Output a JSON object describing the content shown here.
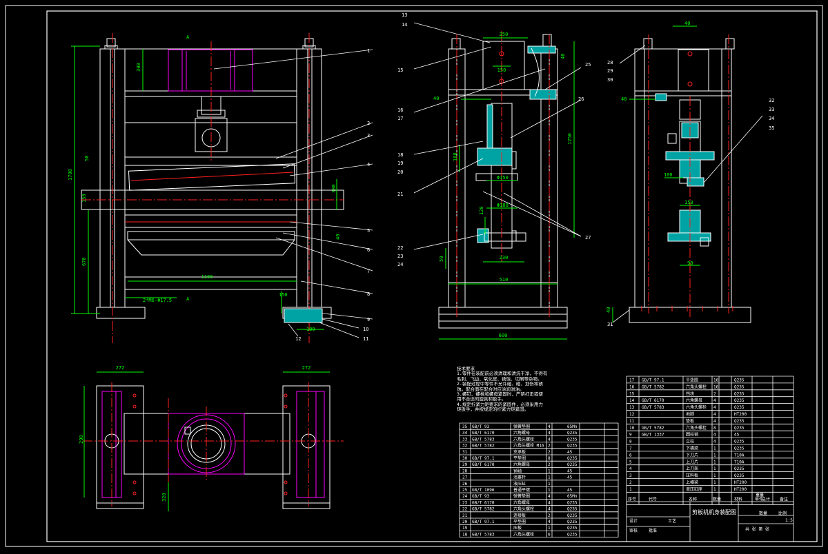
{
  "drawing": {
    "title": "剪板机机身装配图",
    "scale": "1:5",
    "colors": {
      "outline": "#ffffff",
      "section": "#00a3a3",
      "centerline": "#ff2020",
      "hidden": "#ff00ff",
      "dimension": "#00ff00",
      "background": "#000000"
    }
  },
  "front_view": {
    "section_mark_top": "A",
    "section_mark_bottom": "A",
    "dims": {
      "overall_height": "1700",
      "upper": "300",
      "left_gap": "50",
      "mid_left": "150",
      "mid_right": "300",
      "lower": "670",
      "width": "1100",
      "holes": "2*M6-Φ17.5",
      "slot": "150",
      "base": "100",
      "right_small": "40"
    },
    "balloons": [
      "1",
      "2",
      "3",
      "4",
      "5",
      "6",
      "7",
      "8",
      "9",
      "10",
      "11",
      "12"
    ]
  },
  "side_view": {
    "dims": {
      "top": "250",
      "top_right": "40",
      "bolt": "150",
      "height": "1250",
      "left": "40",
      "mid": "100",
      "dia1": "Φ150",
      "dia2": "Φ180",
      "low": "120",
      "base_left": "50",
      "inner": "230",
      "frame": "510",
      "base": "600"
    },
    "balloons": [
      "13",
      "14",
      "15",
      "16",
      "17",
      "18",
      "19",
      "20",
      "21",
      "22",
      "23",
      "24",
      "25",
      "26",
      "27"
    ]
  },
  "right_view": {
    "dims": {
      "top": "40",
      "left": "40",
      "a": "100",
      "b": "90",
      "gap": "150",
      "base": "40"
    },
    "balloons": [
      "28",
      "29",
      "30",
      "31",
      "32",
      "33",
      "34",
      "35"
    ]
  },
  "plan_view": {
    "dims": {
      "left_width": "272",
      "right_width": "272",
      "height": "290",
      "bottom": "320"
    }
  },
  "technical_notes": {
    "heading": "技术要求",
    "lines": [
      "1.零件在装配前必须清理和清洗干净，不得有",
      "毛刺、飞边、氧化皮、锈蚀、切屑等杂物。",
      "2.装配过程中零件不允许磕、碰、划伤和锈",
      "蚀。配合面在配合时应涂润滑油。",
      "3.螺钉、螺栓和螺母紧固时，严禁打击或使",
      "用不合适的旋具和扳手。",
      "4.规定拧紧力矩要求的紧固件，必须采用力",
      "矩扳手，并按规定的拧紧力矩紧固。"
    ]
  },
  "bom_left": {
    "rows": [
      [
        "35",
        "GB/T 93",
        "弹簧垫圈",
        "4",
        "65Mn",
        ""
      ],
      [
        "34",
        "GB/T 6170",
        "六角螺母",
        "4",
        "Q235",
        ""
      ],
      [
        "33",
        "GB/T 5783",
        "六角头螺栓",
        "4",
        "Q235",
        ""
      ],
      [
        "32",
        "GB/T 5782",
        "六角头螺栓 M16",
        "2",
        "Q235",
        ""
      ],
      [
        "31",
        "",
        "支承板",
        "2",
        "45",
        ""
      ],
      [
        "30",
        "GB/T 97.1",
        "平垫圈",
        "8",
        "Q235",
        ""
      ],
      [
        "29",
        "GB/T 6170",
        "六角螺母",
        "2",
        "Q235",
        ""
      ],
      [
        "28",
        "",
        "销轴",
        "1",
        "45",
        ""
      ],
      [
        "27",
        "",
        "活塞杆",
        "1",
        "45",
        ""
      ],
      [
        "26",
        "",
        "液压缸",
        "1",
        "",
        ""
      ],
      [
        "25",
        "GB/T 1096",
        "普通平键",
        "1",
        "45",
        ""
      ],
      [
        "24",
        "GB/T 93",
        "弹簧垫圈",
        "4",
        "65Mn",
        ""
      ],
      [
        "23",
        "GB/T 6170",
        "六角螺母",
        "4",
        "Q235",
        ""
      ],
      [
        "22",
        "GB/T 5782",
        "六角头螺栓",
        "4",
        "Q235",
        ""
      ],
      [
        "21",
        "",
        "连接板",
        "2",
        "Q235",
        ""
      ],
      [
        "20",
        "GB/T 97.1",
        "平垫圈",
        "4",
        "Q235",
        ""
      ],
      [
        "19",
        "",
        "压板",
        "1",
        "Q235",
        ""
      ],
      [
        "18",
        "GB/T 5783",
        "六角头螺栓",
        "6",
        "Q235",
        ""
      ]
    ]
  },
  "bom_right": {
    "rows": [
      [
        "17",
        "GB/T 97.1",
        "平垫圈",
        "16",
        "Q235"
      ],
      [
        "16",
        "GB/T 5782",
        "六角头螺栓",
        "16",
        "Q235"
      ],
      [
        "15",
        "",
        "挡块",
        "2",
        "Q235"
      ],
      [
        "14",
        "GB/T 6170",
        "六角螺母",
        "4",
        "Q235"
      ],
      [
        "13",
        "GB/T 5783",
        "六角头螺栓",
        "4",
        "Q235"
      ],
      [
        "12",
        "",
        "地脚",
        "4",
        "HT200"
      ],
      [
        "11",
        "",
        "垫板",
        "4",
        "Q235"
      ],
      [
        "10",
        "GB/T 5782",
        "六角头螺栓",
        "8",
        "Q235"
      ],
      [
        "9",
        "GB/T 1337",
        "圆柱销",
        "4",
        "45"
      ],
      [
        "8",
        "",
        "立柱",
        "4",
        "Q235"
      ],
      [
        "7",
        "",
        "下横梁",
        "1",
        "Q235"
      ],
      [
        "6",
        "",
        "下刀片",
        "1",
        "T10A"
      ],
      [
        "5",
        "",
        "上刀片",
        "1",
        "T10A"
      ],
      [
        "4",
        "",
        "上刀架",
        "1",
        "Q235"
      ],
      [
        "3",
        "",
        "压料板",
        "1",
        "Q235"
      ],
      [
        "2",
        "",
        "上横梁",
        "1",
        "HT200"
      ],
      [
        "1",
        "",
        "液压缸座",
        "1",
        "HT200"
      ]
    ],
    "header": [
      "序号",
      "代号",
      "名称",
      "数量",
      "材料",
      "单件",
      "总计",
      "备注"
    ],
    "mass_label": "重量"
  },
  "title_block": {
    "labels": {
      "design": "设计",
      "check": "审核",
      "approve": "批准",
      "school": "工艺",
      "qty": "数量",
      "scale_label": "比例",
      "sheet": "共 张 第 张"
    }
  }
}
